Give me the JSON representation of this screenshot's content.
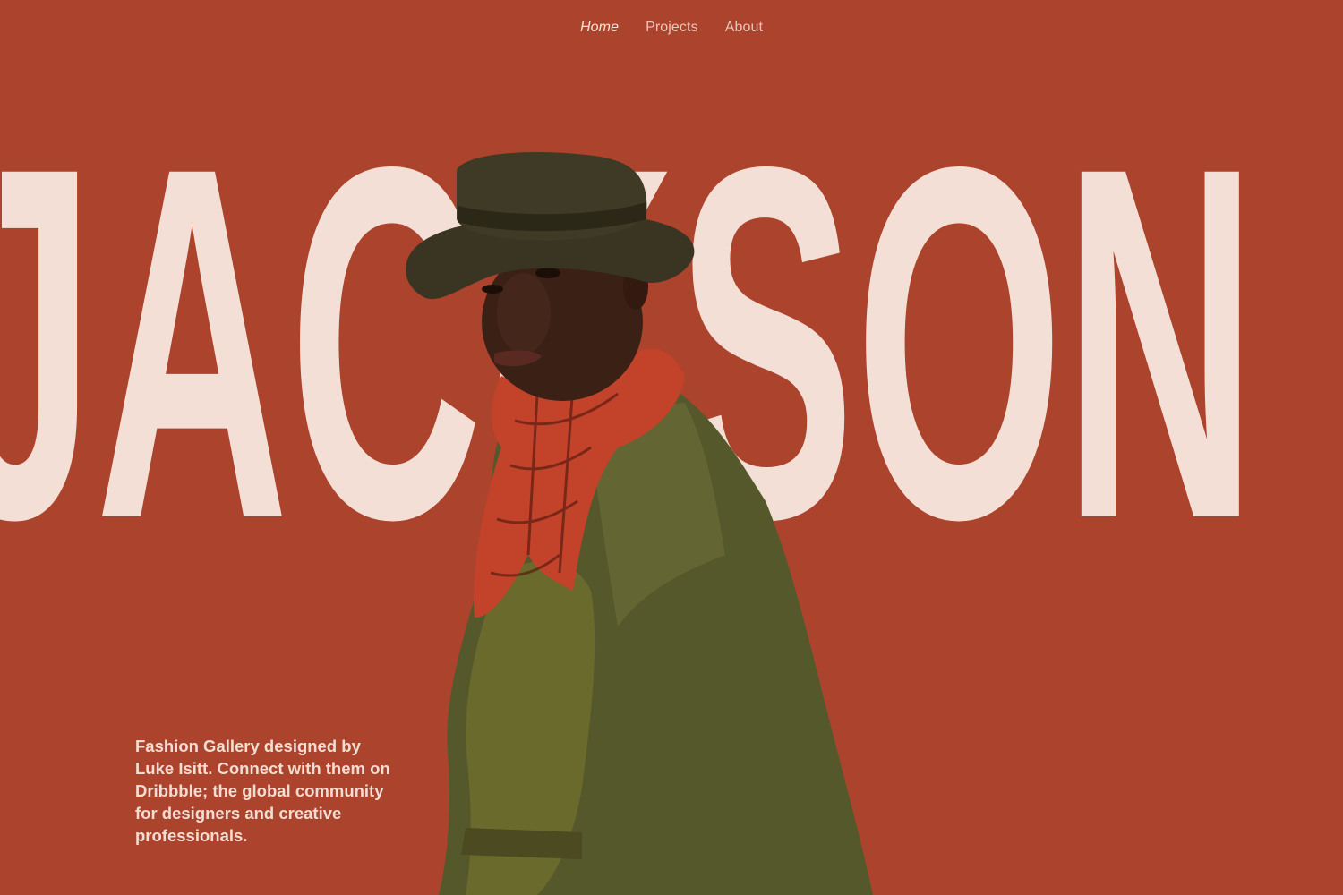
{
  "nav": {
    "items": [
      {
        "label": "Home",
        "active": true
      },
      {
        "label": "Projects",
        "active": false
      },
      {
        "label": "About",
        "active": false
      }
    ]
  },
  "hero": {
    "headline": "JACKSON",
    "image_alt": "model-portrait",
    "description": "Fashion Gallery designed by Luke Isitt. Connect with them on Dribbble; the global community for designers and creative professionals."
  },
  "colors": {
    "background": "#ac432c",
    "headline": "#f3dfd5",
    "text": "#f3dcd2",
    "coat": "#55582b",
    "scarf": "#c2432a",
    "hat": "#3a3522",
    "skin": "#3b2016"
  }
}
